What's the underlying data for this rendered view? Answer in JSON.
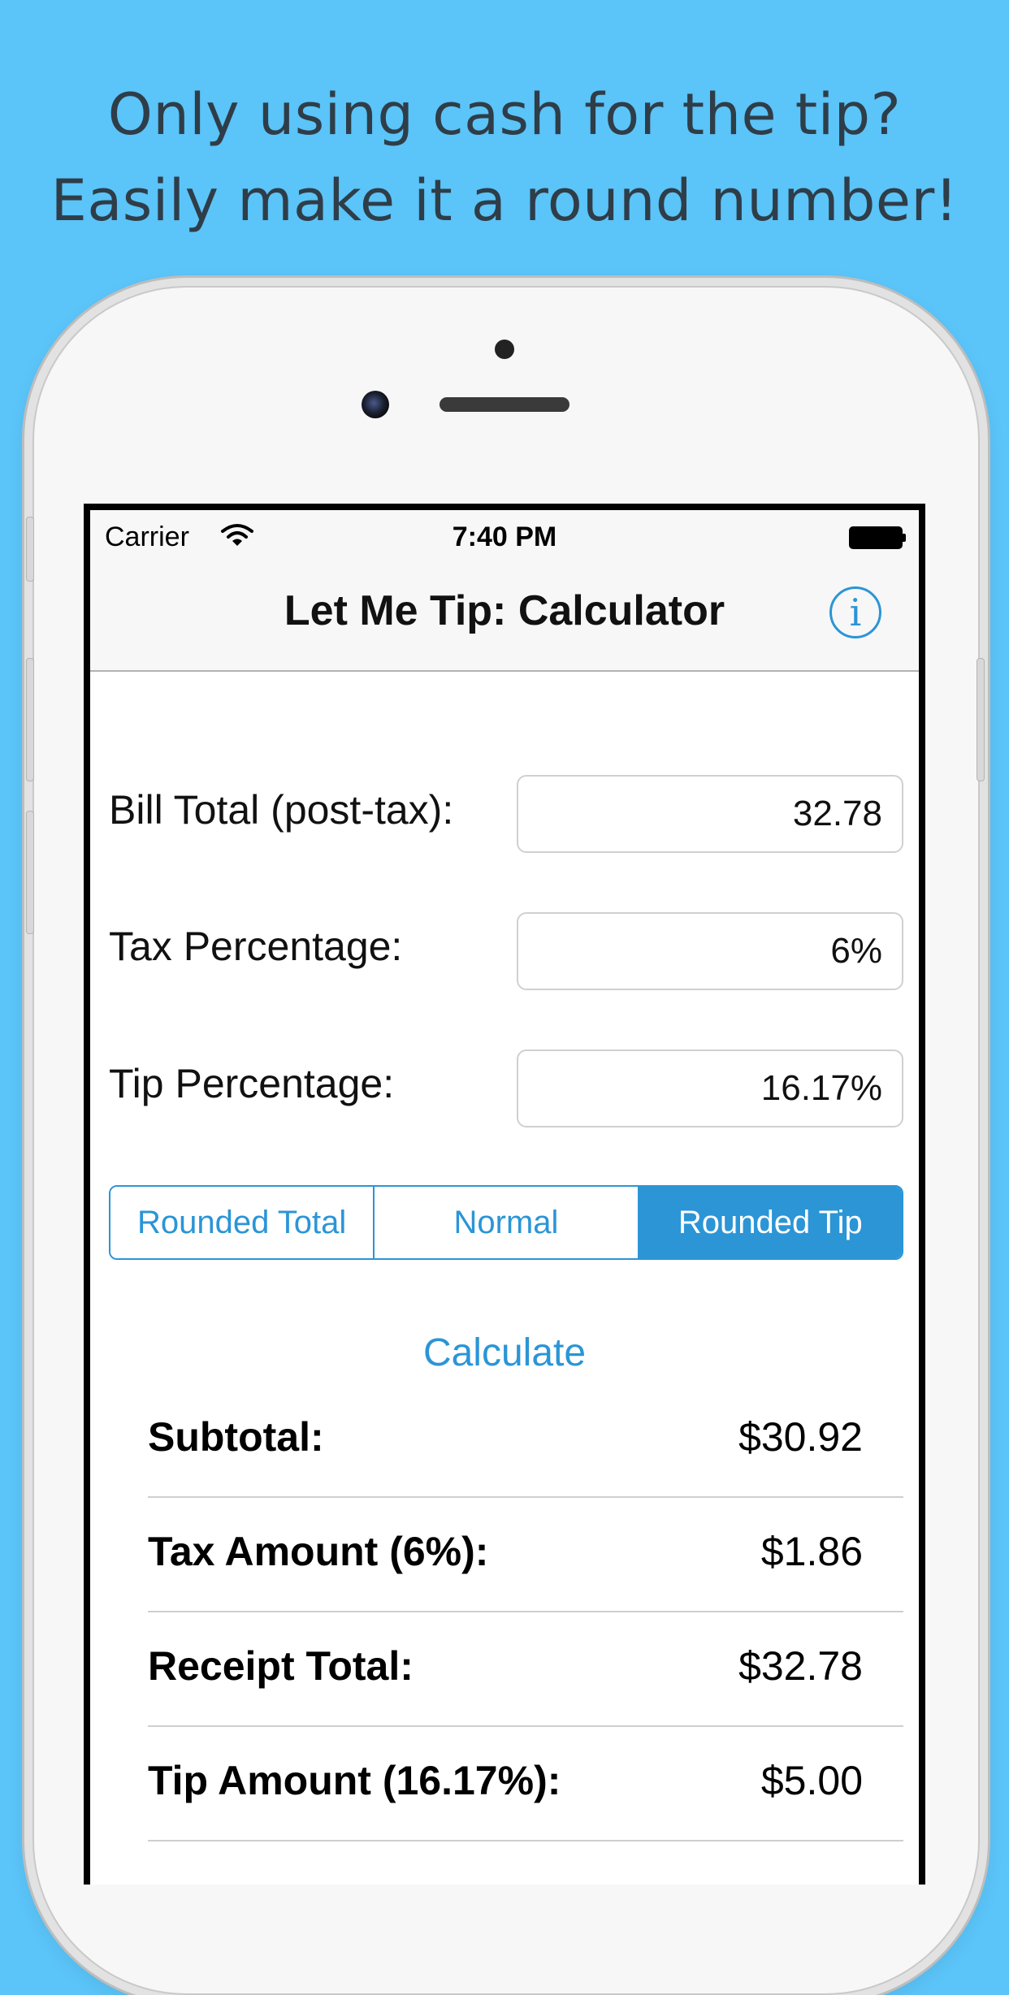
{
  "headline": {
    "line1": "Only using cash for the tip?",
    "line2": "Easily make it a round number!"
  },
  "colors": {
    "background": "#5bc4f8",
    "accent": "#2b95d6",
    "headline_text": "#2f3d48"
  },
  "status_bar": {
    "carrier": "Carrier",
    "time": "7:40 PM",
    "wifi_icon": "wifi-icon",
    "battery_icon": "battery-icon"
  },
  "nav": {
    "title": "Let Me Tip: Calculator",
    "info_glyph": "i"
  },
  "form": {
    "bill_label": "Bill Total (post-tax):",
    "bill_value": "32.78",
    "tax_label": "Tax Percentage:",
    "tax_value": "6%",
    "tip_label": "Tip Percentage:",
    "tip_value": "16.17%"
  },
  "segments": {
    "options": [
      "Rounded Total",
      "Normal",
      "Rounded Tip"
    ],
    "selected": "Rounded Tip"
  },
  "calculate_label": "Calculate",
  "results": [
    {
      "label": "Subtotal:",
      "value": "$30.92"
    },
    {
      "label": "Tax Amount (6%):",
      "value": "$1.86"
    },
    {
      "label": "Receipt Total:",
      "value": "$32.78"
    },
    {
      "label": "Tip Amount (16.17%):",
      "value": "$5.00"
    }
  ]
}
